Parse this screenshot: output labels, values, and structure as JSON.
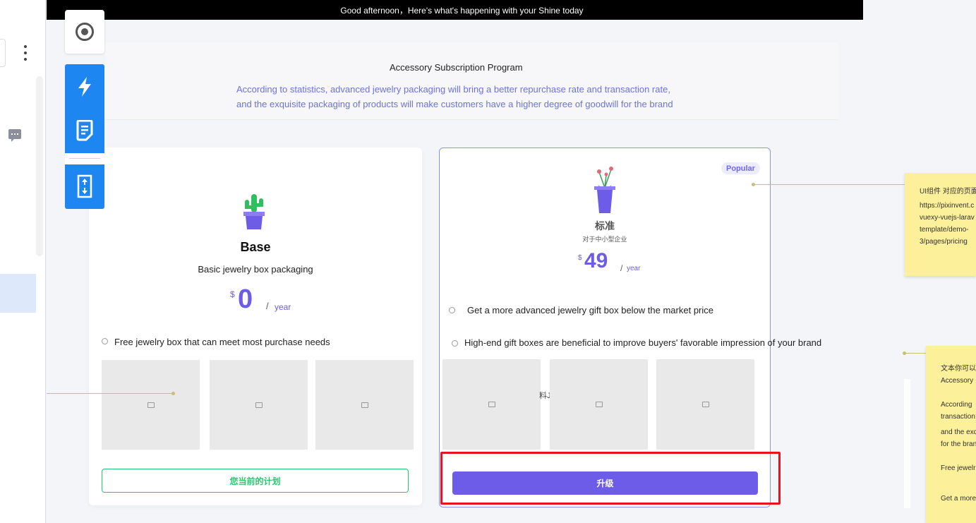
{
  "topbar": {
    "greeting": "Good afternoon，Here's what's happening with your Shine today"
  },
  "header": {
    "title": "Accessory Subscription Program",
    "subtitle_line1": "According to statistics, advanced jewelry packaging will bring a better repurchase rate and transaction rate,",
    "subtitle_line2": "and the exquisite packaging of products will make customers have a higher degree of goodwill for the brand"
  },
  "toolbar": {
    "icons": [
      "target-icon",
      "lightning-icon",
      "document-icon",
      "scroll-vertical-icon"
    ]
  },
  "plans": {
    "base": {
      "name": "Base",
      "description": "Basic jewelry box packaging",
      "currency": "$",
      "price": "0",
      "period_sep": "/",
      "period": "year",
      "features": [
        "Free jewelry box that can meet most purchase needs"
      ],
      "button": "您当前的计划"
    },
    "standard": {
      "badge": "Popular",
      "name": "标准",
      "description": "对于中小型企业",
      "currency": "$",
      "price": "49",
      "period_sep": "/",
      "period": "year",
      "features": [
        "Get a more advanced jewelry gift box below the market price",
        "High-end gift boxes are beneficial to improve buyers' favorable impression of your brand"
      ],
      "overlap_text": "料J",
      "button": "升级"
    }
  },
  "notes": {
    "note1": [
      "UI组件 对应的页面",
      "https://pixinvent.c",
      "vuexy-vuejs-larav",
      "template/demo-",
      "3/pages/pricing"
    ],
    "note2": [
      "文本你可以",
      "Accessory",
      "",
      "According",
      "transaction",
      "",
      "and the exq",
      "for the bran",
      "",
      "Free jewelr",
      "",
      "Get a more"
    ]
  },
  "colors": {
    "accent": "#7367f0",
    "button": "#6c5ce7",
    "success": "#28c76f",
    "toolbar_blue": "#1d86f0",
    "highlight": "#e6141e",
    "note": "#fcf09a"
  }
}
